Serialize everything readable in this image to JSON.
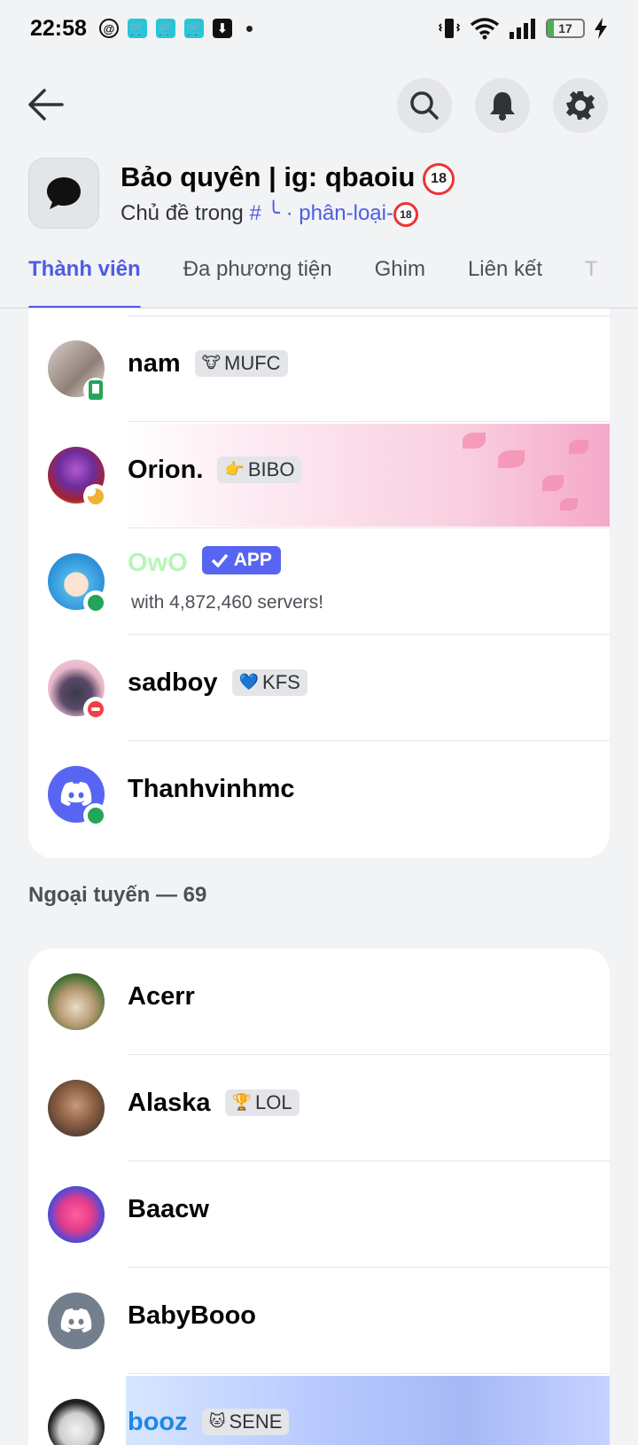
{
  "status_bar": {
    "time": "22:58",
    "battery": "17",
    "notification_icons": [
      "threads-icon",
      "shopee-icon",
      "shopee-icon",
      "shopee-icon",
      "download-icon",
      "dot"
    ],
    "system_icons": [
      "vibrate-icon",
      "wifi-icon",
      "signal-icon",
      "battery-icon",
      "charging-icon"
    ]
  },
  "header": {
    "channel_title": "Bảo quyên | ig: qbaoiu",
    "age_badge": "18",
    "subtitle_prefix": "Chủ đề trong",
    "parent_channel": "# ╰ · phân-loại-",
    "parent_badge": "18"
  },
  "tabs": [
    {
      "label": "Thành viên",
      "active": true
    },
    {
      "label": "Đa phương tiện",
      "active": false
    },
    {
      "label": "Ghim",
      "active": false
    },
    {
      "label": "Liên kết",
      "active": false
    },
    {
      "label": "T",
      "active": false
    }
  ],
  "online_members": [
    {
      "name": "nam",
      "tag": "MUFC",
      "tag_icon": "🐮",
      "status": "mobile"
    },
    {
      "name": "Orion.",
      "tag": "BIBO",
      "tag_icon": "👉",
      "status": "idle"
    },
    {
      "name": "OwO",
      "app_label": "APP",
      "subline": "with 4,872,460 servers!",
      "status": "online"
    },
    {
      "name": "sadboy",
      "tag": "KFS",
      "tag_icon": "💙",
      "status": "dnd"
    },
    {
      "name": "Thanhvinhmc",
      "status": "online"
    }
  ],
  "offline_section": {
    "label": "Ngoại tuyến — 69"
  },
  "offline_members": [
    {
      "name": "Acerr"
    },
    {
      "name": "Alaska",
      "tag": "LOL",
      "tag_icon": "🏆"
    },
    {
      "name": "Baacw"
    },
    {
      "name": "BabyBooo"
    },
    {
      "name": "booz",
      "tag": "SENE",
      "tag_icon": "🐱"
    }
  ],
  "colors": {
    "accent": "#4e5de0",
    "online": "#23a55a",
    "idle": "#f0b232",
    "dnd": "#f23f43",
    "owo_name": "#b9f5b9",
    "booz_name": "#1e88e5"
  }
}
